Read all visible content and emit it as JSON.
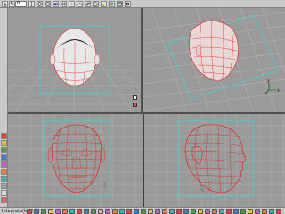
{
  "toolbar": {
    "frame_value": "0",
    "icons": [
      "select-arrow-icon",
      "move-icon",
      "rotate-icon",
      "scale-icon",
      "camera-icon",
      "grid-icon",
      "snap-icon",
      "render-icon",
      "light-icon",
      "curve-icon",
      "surface-icon",
      "polygon-icon",
      "window-icon",
      "settings-icon"
    ]
  },
  "viewports": {
    "persp_a": {
      "corner_buttons": [
        "maximize-icon",
        "camera-icon"
      ]
    },
    "persp_b": {
      "axis_label_x": "x",
      "axis_label_y": "y"
    },
    "front": {
      "axis_number": "4"
    },
    "side": {
      "axis_number": "4"
    }
  },
  "helpline": {
    "text": "Integrate(left)"
  },
  "colors": {
    "wireframe": "#e0271f",
    "grid": "#b4b4b4",
    "bounding_box": "#3ad8d8",
    "viewport_bg": "#9a9a9a"
  }
}
